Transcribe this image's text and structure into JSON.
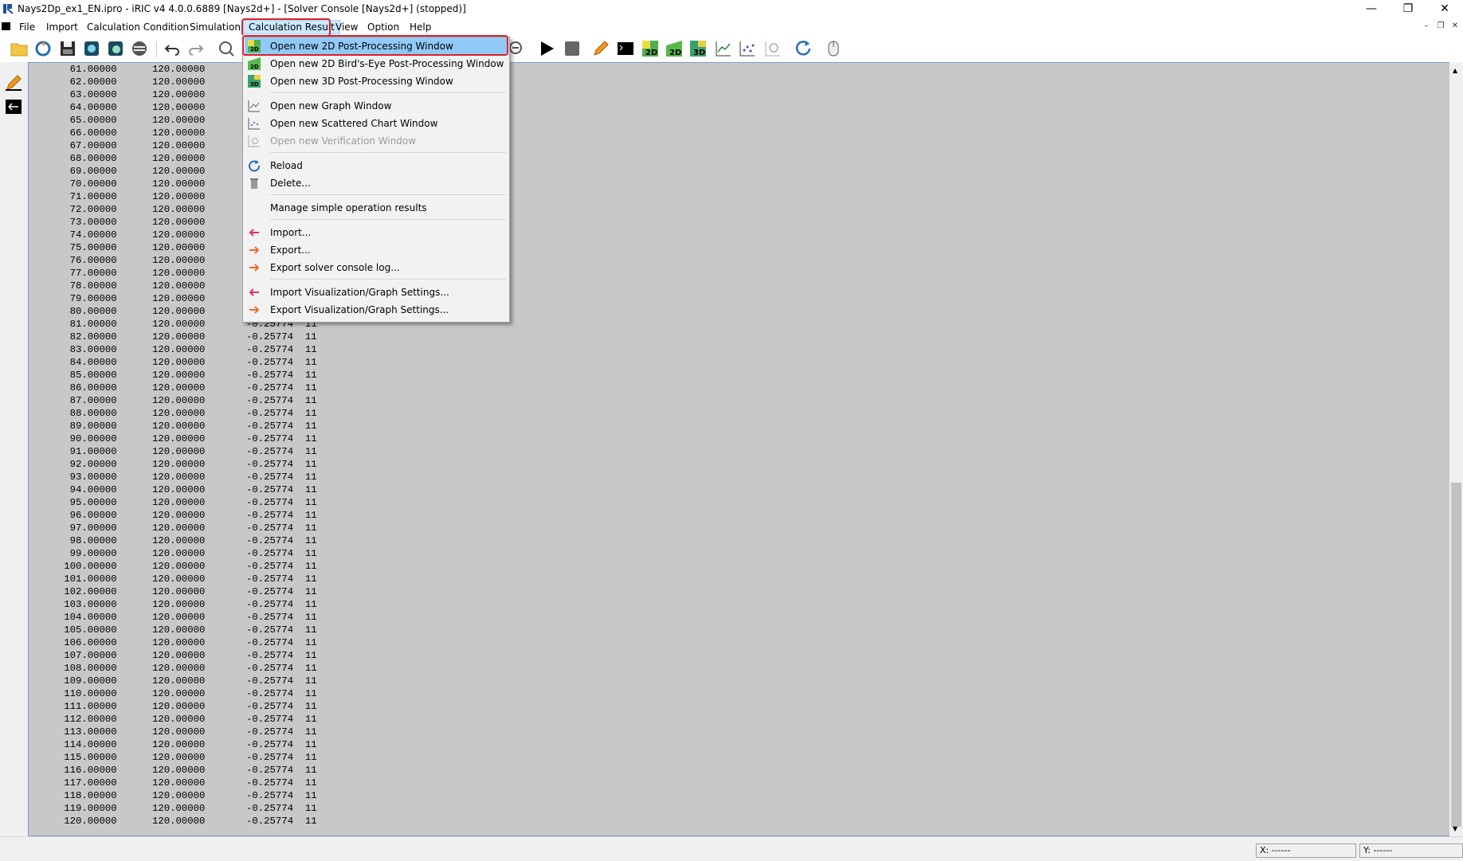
{
  "window": {
    "title": "Nays2Dp_ex1_EN.ipro - iRIC v4 4.0.0.6889 [Nays2d+] - [Solver Console [Nays2d+] (stopped)]",
    "controls": {
      "minimize": "—",
      "restore": "❐",
      "close": "✕"
    },
    "mdi_controls": {
      "minimize": "–",
      "restore": "❐",
      "close": "✕"
    }
  },
  "menubar": {
    "items": [
      "File",
      "Import",
      "Calculation Condition",
      "Simulation",
      "Calculation Result",
      "View",
      "Option",
      "Help"
    ],
    "active_index": 4
  },
  "dropdown": {
    "items": [
      {
        "label": "Open new 2D Post-Processing Window",
        "icon": "2d-postprocess-icon",
        "selected": true
      },
      {
        "label": "Open new 2D Bird's-Eye Post-Processing Window",
        "icon": "2d-birdseye-icon"
      },
      {
        "label": "Open new 3D Post-Processing Window",
        "icon": "3d-postprocess-icon"
      },
      {
        "label": "Open new Graph Window",
        "icon": "graph-icon"
      },
      {
        "label": "Open new Scattered Chart Window",
        "icon": "scatter-chart-icon"
      },
      {
        "label": "Open new Verification Window",
        "icon": "verification-icon",
        "disabled": true
      },
      {
        "label": "Reload",
        "icon": "reload-icon"
      },
      {
        "label": "Delete...",
        "icon": "trash-icon"
      },
      {
        "label": "Manage simple operation results",
        "icon": ""
      },
      {
        "label": "Import...",
        "icon": "import-arrow-icon"
      },
      {
        "label": "Export...",
        "icon": "export-arrow-icon"
      },
      {
        "label": "Export solver console log...",
        "icon": "export-arrow-icon"
      },
      {
        "label": "Import Visualization/Graph Settings...",
        "icon": "import-arrow-icon"
      },
      {
        "label": "Export Visualization/Graph Settings...",
        "icon": "export-arrow-icon"
      }
    ]
  },
  "console": {
    "lines": [
      "       61.00000      120.00000",
      "       62.00000      120.00000",
      "       63.00000      120.00000",
      "       64.00000      120.00000",
      "       65.00000      120.00000",
      "       66.00000      120.00000",
      "       67.00000      120.00000",
      "       68.00000      120.00000",
      "       69.00000      120.00000",
      "       70.00000      120.00000",
      "       71.00000      120.00000",
      "       72.00000      120.00000",
      "       73.00000      120.00000",
      "       74.00000      120.00000",
      "       75.00000      120.00000",
      "       76.00000      120.00000",
      "       77.00000      120.00000",
      "       78.00000      120.00000",
      "       79.00000      120.00000",
      "       80.00000      120.00000",
      "       81.00000      120.00000       -0.25774  11",
      "       82.00000      120.00000       -0.25774  11",
      "       83.00000      120.00000       -0.25774  11",
      "       84.00000      120.00000       -0.25774  11",
      "       85.00000      120.00000       -0.25774  11",
      "       86.00000      120.00000       -0.25774  11",
      "       87.00000      120.00000       -0.25774  11",
      "       88.00000      120.00000       -0.25774  11",
      "       89.00000      120.00000       -0.25774  11",
      "       90.00000      120.00000       -0.25774  11",
      "       91.00000      120.00000       -0.25774  11",
      "       92.00000      120.00000       -0.25774  11",
      "       93.00000      120.00000       -0.25774  11",
      "       94.00000      120.00000       -0.25774  11",
      "       95.00000      120.00000       -0.25774  11",
      "       96.00000      120.00000       -0.25774  11",
      "       97.00000      120.00000       -0.25774  11",
      "       98.00000      120.00000       -0.25774  11",
      "       99.00000      120.00000       -0.25774  11",
      "      100.00000      120.00000       -0.25774  11",
      "      101.00000      120.00000       -0.25774  11",
      "      102.00000      120.00000       -0.25774  11",
      "      103.00000      120.00000       -0.25774  11",
      "      104.00000      120.00000       -0.25774  11",
      "      105.00000      120.00000       -0.25774  11",
      "      106.00000      120.00000       -0.25774  11",
      "      107.00000      120.00000       -0.25774  11",
      "      108.00000      120.00000       -0.25774  11",
      "      109.00000      120.00000       -0.25774  11",
      "      110.00000      120.00000       -0.25774  11",
      "      111.00000      120.00000       -0.25774  11",
      "      112.00000      120.00000       -0.25774  11",
      "      113.00000      120.00000       -0.25774  11",
      "      114.00000      120.00000       -0.25774  11",
      "      115.00000      120.00000       -0.25774  11",
      "      116.00000      120.00000       -0.25774  11",
      "      117.00000      120.00000       -0.25774  11",
      "      118.00000      120.00000       -0.25774  11",
      "      119.00000      120.00000       -0.25774  11",
      "      120.00000      120.00000       -0.25774  11"
    ]
  },
  "statusbar": {
    "x": "X: ------",
    "y": "Y: ------"
  },
  "colors": {
    "highlight": "#e0202a",
    "selected": "#91c9f7",
    "console_bg": "#c8c8c8"
  }
}
